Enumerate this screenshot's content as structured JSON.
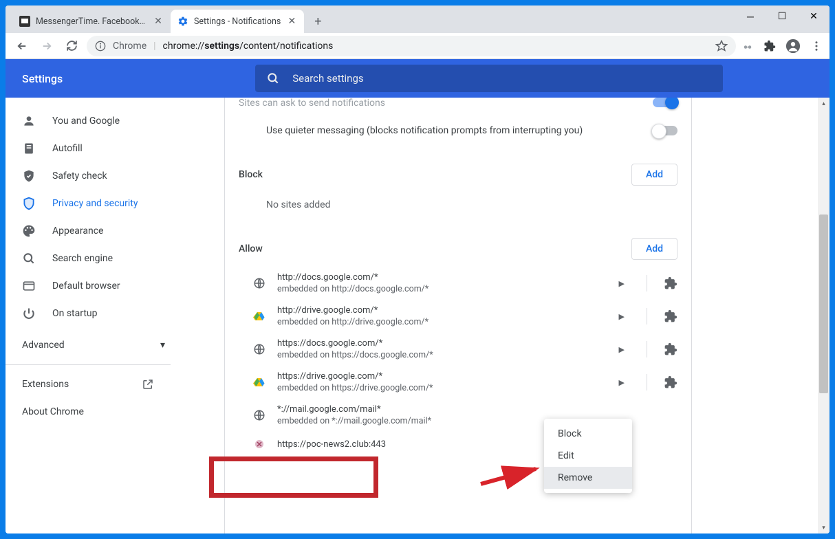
{
  "window": {
    "tabs": [
      {
        "title": "MessengerTime. Facebook Mess…",
        "active": false
      },
      {
        "title": "Settings - Notifications",
        "active": true
      }
    ]
  },
  "addressbar": {
    "label": "Chrome",
    "url_prefix": "chrome://",
    "url_bold": "settings",
    "url_suffix": "/content/notifications"
  },
  "header": {
    "title": "Settings",
    "search_placeholder": "Search settings"
  },
  "sidebar": {
    "items": [
      {
        "label": "You and Google",
        "icon": "person"
      },
      {
        "label": "Autofill",
        "icon": "autofill"
      },
      {
        "label": "Safety check",
        "icon": "shield-check"
      },
      {
        "label": "Privacy and security",
        "icon": "shield",
        "active": true
      },
      {
        "label": "Appearance",
        "icon": "palette"
      },
      {
        "label": "Search engine",
        "icon": "search"
      },
      {
        "label": "Default browser",
        "icon": "browser"
      },
      {
        "label": "On startup",
        "icon": "power"
      }
    ],
    "advanced": "Advanced",
    "extensions": "Extensions",
    "about": "About Chrome"
  },
  "content": {
    "ask_row": "Sites can ask to send notifications",
    "quieter_row": "Use quieter messaging (blocks notification prompts from interrupting you)",
    "block_section": "Block",
    "block_empty": "No sites added",
    "allow_section": "Allow",
    "add_button": "Add",
    "allow_sites": [
      {
        "url": "http://docs.google.com/*",
        "embed": "embedded on http://docs.google.com/*",
        "icon": "globe"
      },
      {
        "url": "http://drive.google.com/*",
        "embed": "embedded on http://drive.google.com/*",
        "icon": "drive"
      },
      {
        "url": "https://docs.google.com/*",
        "embed": "embedded on https://docs.google.com/*",
        "icon": "globe"
      },
      {
        "url": "https://drive.google.com/*",
        "embed": "embedded on https://drive.google.com/*",
        "icon": "drive"
      },
      {
        "url": "*://mail.google.com/mail*",
        "embed": "embedded on *://mail.google.com/mail*",
        "icon": "globe"
      },
      {
        "url": "https://poc-news2.club:443",
        "embed": "",
        "icon": "spam"
      }
    ]
  },
  "context_menu": {
    "items": [
      "Block",
      "Edit",
      "Remove"
    ],
    "hovered": 2
  }
}
